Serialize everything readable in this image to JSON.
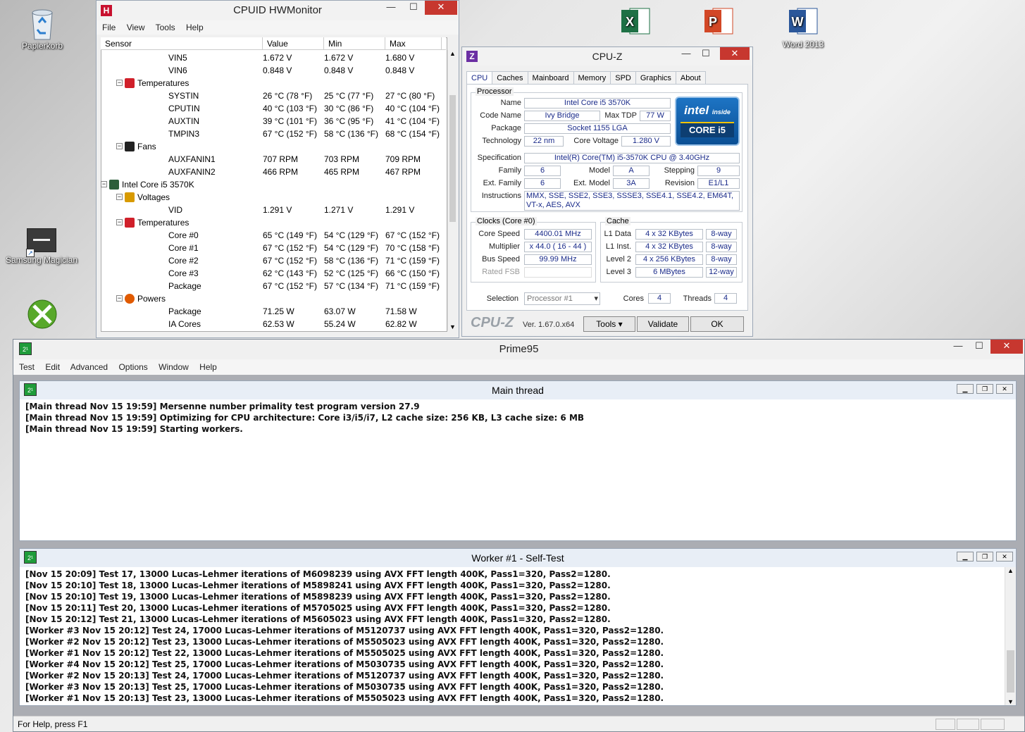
{
  "desktop": {
    "icons": [
      {
        "label": "Papierkorb"
      },
      {
        "label": "Samsung Magician"
      },
      {
        "label": "Word 2013"
      }
    ]
  },
  "hwmonitor": {
    "title": "CPUID HWMonitor",
    "menu": [
      "File",
      "View",
      "Tools",
      "Help"
    ],
    "columns": [
      "Sensor",
      "Value",
      "Min",
      "Max"
    ],
    "rows": [
      {
        "name": "VIN5",
        "value": "1.672 V",
        "min": "1.672 V",
        "max": "1.680 V"
      },
      {
        "name": "VIN6",
        "value": "0.848 V",
        "min": "0.848 V",
        "max": "0.848 V"
      },
      {
        "name": "Temperatures",
        "value": "",
        "min": "",
        "max": ""
      },
      {
        "name": "SYSTIN",
        "value": "26 °C  (78 °F)",
        "min": "25 °C  (77 °F)",
        "max": "27 °C  (80 °F)"
      },
      {
        "name": "CPUTIN",
        "value": "40 °C  (103 °F)",
        "min": "30 °C  (86 °F)",
        "max": "40 °C  (104 °F)"
      },
      {
        "name": "AUXTIN",
        "value": "39 °C  (101 °F)",
        "min": "36 °C  (95 °F)",
        "max": "41 °C  (104 °F)"
      },
      {
        "name": "TMPIN3",
        "value": "67 °C  (152 °F)",
        "min": "58 °C  (136 °F)",
        "max": "68 °C  (154 °F)"
      },
      {
        "name": "Fans",
        "value": "",
        "min": "",
        "max": ""
      },
      {
        "name": "AUXFANIN1",
        "value": "707 RPM",
        "min": "703 RPM",
        "max": "709 RPM"
      },
      {
        "name": "AUXFANIN2",
        "value": "466 RPM",
        "min": "465 RPM",
        "max": "467 RPM"
      },
      {
        "name": "Intel Core i5 3570K",
        "value": "",
        "min": "",
        "max": ""
      },
      {
        "name": "Voltages",
        "value": "",
        "min": "",
        "max": ""
      },
      {
        "name": "VID",
        "value": "1.291 V",
        "min": "1.271 V",
        "max": "1.291 V"
      },
      {
        "name": "Temperatures",
        "value": "",
        "min": "",
        "max": ""
      },
      {
        "name": "Core #0",
        "value": "65 °C  (149 °F)",
        "min": "54 °C  (129 °F)",
        "max": "67 °C  (152 °F)"
      },
      {
        "name": "Core #1",
        "value": "67 °C  (152 °F)",
        "min": "54 °C  (129 °F)",
        "max": "70 °C  (158 °F)"
      },
      {
        "name": "Core #2",
        "value": "67 °C  (152 °F)",
        "min": "58 °C  (136 °F)",
        "max": "71 °C  (159 °F)"
      },
      {
        "name": "Core #3",
        "value": "62 °C  (143 °F)",
        "min": "52 °C  (125 °F)",
        "max": "66 °C  (150 °F)"
      },
      {
        "name": "Package",
        "value": "67 °C  (152 °F)",
        "min": "57 °C  (134 °F)",
        "max": "71 °C  (159 °F)"
      },
      {
        "name": "Powers",
        "value": "",
        "min": "",
        "max": ""
      },
      {
        "name": "Package",
        "value": "71.25 W",
        "min": "63.07 W",
        "max": "71.58 W"
      },
      {
        "name": "IA Cores",
        "value": "62.53 W",
        "min": "55.24 W",
        "max": "62.82 W"
      }
    ]
  },
  "cpuz": {
    "title": "CPU-Z",
    "tabs": [
      "CPU",
      "Caches",
      "Mainboard",
      "Memory",
      "SPD",
      "Graphics",
      "About"
    ],
    "processor_label": "Processor",
    "labels": {
      "name": "Name",
      "codename": "Code Name",
      "maxtdp": "Max TDP",
      "package": "Package",
      "technology": "Technology",
      "corevoltage": "Core Voltage",
      "specification": "Specification",
      "family": "Family",
      "model": "Model",
      "stepping": "Stepping",
      "extfamily": "Ext. Family",
      "extmodel": "Ext. Model",
      "revision": "Revision",
      "instructions": "Instructions"
    },
    "values": {
      "name": "Intel Core i5 3570K",
      "codename": "Ivy Bridge",
      "maxtdp": "77 W",
      "package": "Socket 1155 LGA",
      "technology": "22 nm",
      "corevoltage": "1.280 V",
      "specification": "Intel(R) Core(TM) i5-3570K CPU @ 3.40GHz",
      "family": "6",
      "model": "A",
      "stepping": "9",
      "extfamily": "6",
      "extmodel": "3A",
      "revision": "E1/L1",
      "instructions": "MMX, SSE, SSE2, SSE3, SSSE3, SSE4.1, SSE4.2, EM64T, VT-x, AES, AVX"
    },
    "logo": {
      "line1": "intel",
      "line2": "inside",
      "line3": "CORE i5"
    },
    "clocks": {
      "title": "Clocks (Core #0)",
      "core_speed_label": "Core Speed",
      "core_speed": "4400.01 MHz",
      "multiplier_label": "Multiplier",
      "multiplier": "x 44.0  ( 16 - 44 )",
      "bus_speed_label": "Bus Speed",
      "bus_speed": "99.99 MHz",
      "rated_fsb_label": "Rated FSB",
      "rated_fsb": ""
    },
    "cache": {
      "title": "Cache",
      "rows": [
        {
          "label": "L1 Data",
          "size": "4 x 32 KBytes",
          "way": "8-way"
        },
        {
          "label": "L1 Inst.",
          "size": "4 x 32 KBytes",
          "way": "8-way"
        },
        {
          "label": "Level 2",
          "size": "4 x 256 KBytes",
          "way": "8-way"
        },
        {
          "label": "Level 3",
          "size": "6 MBytes",
          "way": "12-way"
        }
      ]
    },
    "selection_label": "Selection",
    "selection": "Processor #1",
    "cores_label": "Cores",
    "cores": "4",
    "threads_label": "Threads",
    "threads": "4",
    "brand": "CPU-Z",
    "version": "Ver. 1.67.0.x64",
    "tools": "Tools",
    "validate": "Validate",
    "ok": "OK"
  },
  "prime95": {
    "title": "Prime95",
    "menu": [
      "Test",
      "Edit",
      "Advanced",
      "Options",
      "Window",
      "Help"
    ],
    "main_thread": {
      "title": "Main thread",
      "lines": [
        "[Main thread Nov 15 19:59] Mersenne number primality test program version 27.9",
        "[Main thread Nov 15 19:59] Optimizing for CPU architecture: Core i3/i5/i7, L2 cache size: 256 KB, L3 cache size: 6 MB",
        "[Main thread Nov 15 19:59] Starting workers."
      ]
    },
    "worker": {
      "title": "Worker #1 - Self-Test",
      "lines": [
        "[Nov 15 20:09] Test 17, 13000 Lucas-Lehmer iterations of M6098239 using AVX FFT length 400K, Pass1=320, Pass2=1280.",
        "[Nov 15 20:10] Test 18, 13000 Lucas-Lehmer iterations of M5898241 using AVX FFT length 400K, Pass1=320, Pass2=1280.",
        "[Nov 15 20:10] Test 19, 13000 Lucas-Lehmer iterations of M5898239 using AVX FFT length 400K, Pass1=320, Pass2=1280.",
        "[Nov 15 20:11] Test 20, 13000 Lucas-Lehmer iterations of M5705025 using AVX FFT length 400K, Pass1=320, Pass2=1280.",
        "[Nov 15 20:12] Test 21, 13000 Lucas-Lehmer iterations of M5605023 using AVX FFT length 400K, Pass1=320, Pass2=1280.",
        "[Worker #3 Nov 15 20:12] Test 24, 17000 Lucas-Lehmer iterations of M5120737 using AVX FFT length 400K, Pass1=320, Pass2=1280.",
        "[Worker #2 Nov 15 20:12] Test 23, 13000 Lucas-Lehmer iterations of M5505023 using AVX FFT length 400K, Pass1=320, Pass2=1280.",
        "[Worker #1 Nov 15 20:12] Test 22, 13000 Lucas-Lehmer iterations of M5505025 using AVX FFT length 400K, Pass1=320, Pass2=1280.",
        "[Worker #4 Nov 15 20:12] Test 25, 17000 Lucas-Lehmer iterations of M5030735 using AVX FFT length 400K, Pass1=320, Pass2=1280.",
        "[Worker #2 Nov 15 20:13] Test 24, 17000 Lucas-Lehmer iterations of M5120737 using AVX FFT length 400K, Pass1=320, Pass2=1280.",
        "[Worker #3 Nov 15 20:13] Test 25, 17000 Lucas-Lehmer iterations of M5030735 using AVX FFT length 400K, Pass1=320, Pass2=1280.",
        "[Worker #1 Nov 15 20:13] Test 23, 13000 Lucas-Lehmer iterations of M5505023 using AVX FFT length 400K, Pass1=320, Pass2=1280."
      ]
    },
    "status": "For Help, press F1"
  },
  "colors": {
    "intel_blue": "#0b6bb5",
    "close_red": "#c7372f",
    "prime_green": "#1f9c3a"
  },
  "icons": [
    "recycle-bin-icon",
    "excel-icon",
    "powerpoint-icon",
    "word-icon",
    "samsung-magician-icon",
    "xbox-icon",
    "hwmonitor-icon",
    "cpuz-icon",
    "prime95-icon"
  ]
}
